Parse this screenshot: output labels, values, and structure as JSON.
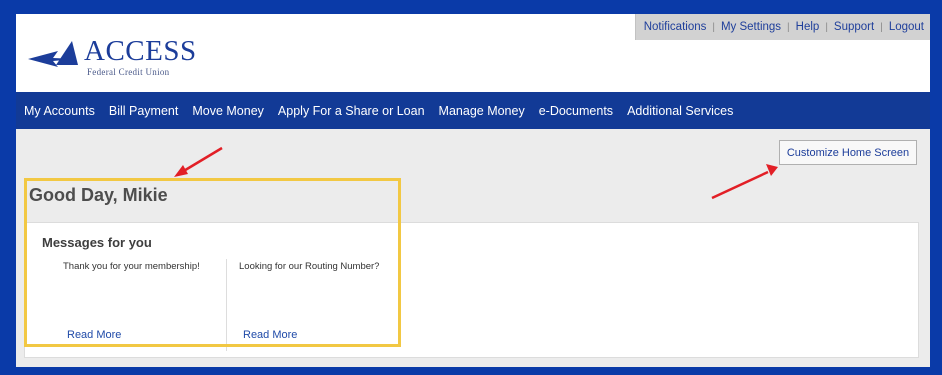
{
  "brand": {
    "logo_word": "ACCESS",
    "logo_sub": "Federal Credit Union"
  },
  "utility_nav": [
    {
      "label": "Notifications"
    },
    {
      "label": "My Settings"
    },
    {
      "label": "Help"
    },
    {
      "label": "Support"
    },
    {
      "label": "Logout"
    }
  ],
  "main_nav": [
    {
      "label": "My Accounts"
    },
    {
      "label": "Bill Payment"
    },
    {
      "label": "Move Money"
    },
    {
      "label": "Apply For a Share or Loan"
    },
    {
      "label": "Manage Money"
    },
    {
      "label": "e-Documents"
    },
    {
      "label": "Additional Services"
    }
  ],
  "customize_button": "Customize Home Screen",
  "greeting": "Good Day, Mikie",
  "messages": {
    "title": "Messages for you",
    "items": [
      {
        "text": "Thank you for your membership!",
        "link": "Read More"
      },
      {
        "text": "Looking for our Routing Number?",
        "link": "Read More"
      }
    ]
  },
  "colors": {
    "frame_border": "#0a3aa8",
    "nav_bar": "#123a96",
    "highlight_box": "#f2c843",
    "annotation_arrow": "#e21f26",
    "link": "#1f4aa8"
  }
}
